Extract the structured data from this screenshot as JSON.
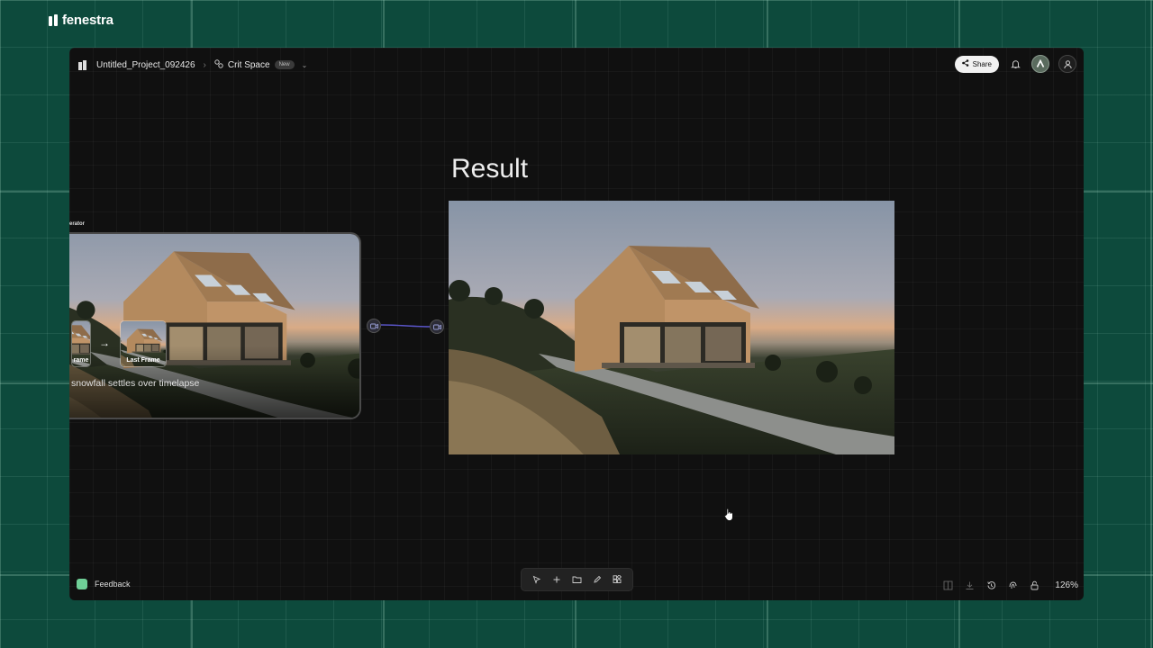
{
  "brand": {
    "name": "fenestra"
  },
  "topbar": {
    "project_title": "Untitled_Project_092426",
    "breadcrumb_separator": "›",
    "space_name": "Crit Space",
    "space_badge": "New",
    "share_label": "Share"
  },
  "generator": {
    "label": "erator",
    "first_frame_label": "rame",
    "last_frame_label": "Last Frame",
    "prompt": "snowfall settles over timelapse"
  },
  "result": {
    "title": "Result"
  },
  "feedback": {
    "label": "Feedback"
  },
  "toolbar": {
    "tools": [
      "pointer-icon",
      "plus-icon",
      "folder-icon",
      "pencil-icon",
      "apps-icon"
    ]
  },
  "status": {
    "zoom": "126%"
  },
  "colors": {
    "outer_background": "#0d4a3c",
    "canvas": "#101010",
    "connector": "#5a55c8",
    "feedback_icon": "#6fcf97"
  }
}
